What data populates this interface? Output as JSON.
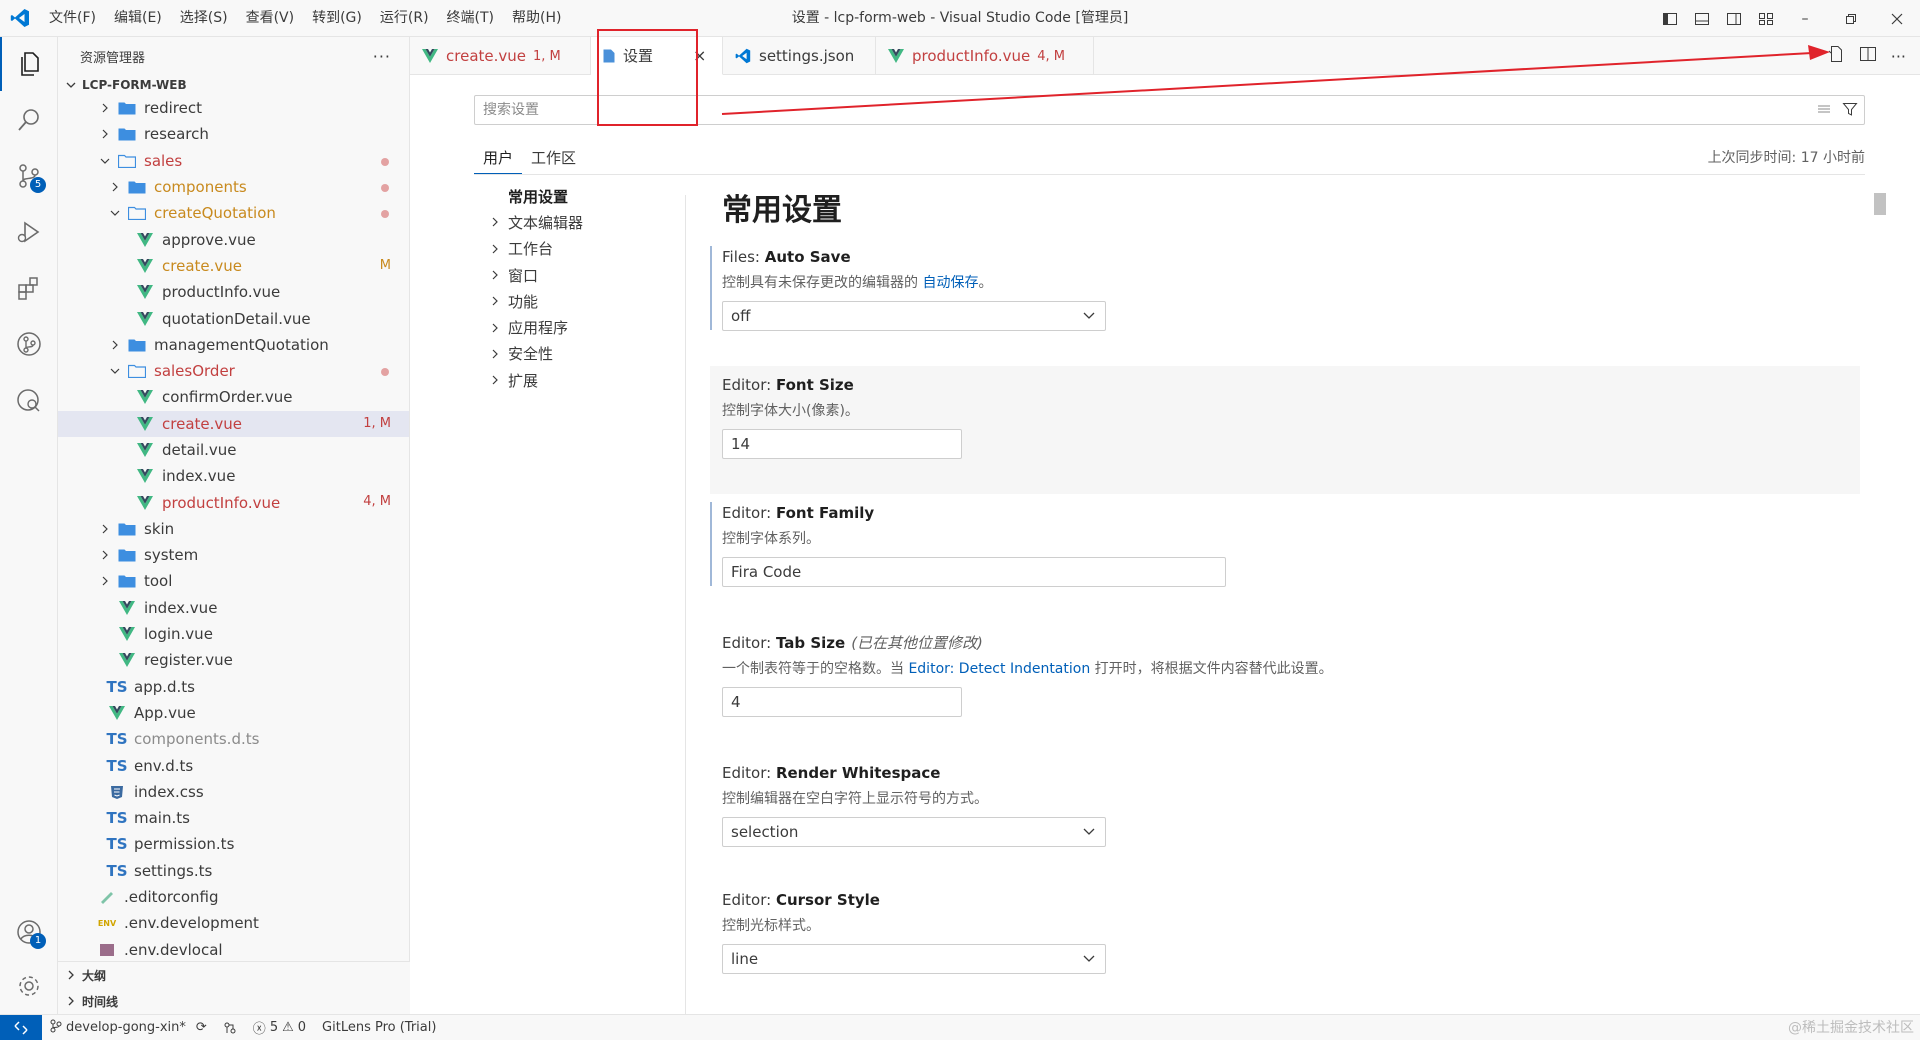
{
  "window": {
    "title": "设置 - lcp-form-web - Visual Studio Code [管理员]",
    "menu": [
      "文件(F)",
      "编辑(E)",
      "选择(S)",
      "查看(V)",
      "转到(G)",
      "运行(R)",
      "终端(T)",
      "帮助(H)"
    ]
  },
  "activitybar": {
    "source_control_badge": "5",
    "accounts_badge": "1"
  },
  "sidebar": {
    "title": "资源管理器",
    "more": "···",
    "root": "LCP-FORM-WEB",
    "items": [
      {
        "label": "redirect",
        "status": ""
      },
      {
        "label": "research",
        "status": ""
      },
      {
        "label": "sales",
        "status": ""
      },
      {
        "label": "components",
        "status": ""
      },
      {
        "label": "createQuotation",
        "status": ""
      },
      {
        "label": "approve.vue",
        "status": ""
      },
      {
        "label": "create.vue",
        "status": "M"
      },
      {
        "label": "productInfo.vue",
        "status": ""
      },
      {
        "label": "quotationDetail.vue",
        "status": ""
      },
      {
        "label": "managementQuotation",
        "status": ""
      },
      {
        "label": "salesOrder",
        "status": ""
      },
      {
        "label": "confirmOrder.vue",
        "status": ""
      },
      {
        "label": "create.vue",
        "status": "1, M"
      },
      {
        "label": "detail.vue",
        "status": ""
      },
      {
        "label": "index.vue",
        "status": ""
      },
      {
        "label": "productInfo.vue",
        "status": "4, M"
      },
      {
        "label": "skin",
        "status": ""
      },
      {
        "label": "system",
        "status": ""
      },
      {
        "label": "tool",
        "status": ""
      },
      {
        "label": "index.vue",
        "status": ""
      },
      {
        "label": "login.vue",
        "status": ""
      },
      {
        "label": "register.vue",
        "status": ""
      },
      {
        "label": "app.d.ts",
        "status": ""
      },
      {
        "label": "App.vue",
        "status": ""
      },
      {
        "label": "components.d.ts",
        "status": ""
      },
      {
        "label": "env.d.ts",
        "status": ""
      },
      {
        "label": "index.css",
        "status": ""
      },
      {
        "label": "main.ts",
        "status": ""
      },
      {
        "label": "permission.ts",
        "status": ""
      },
      {
        "label": "settings.ts",
        "status": ""
      },
      {
        "label": ".editorconfig",
        "status": ""
      },
      {
        "label": ".env.development",
        "status": ""
      },
      {
        "label": ".env.devlocal",
        "status": ""
      }
    ],
    "ts_glyph": "TS",
    "env_glyph": "ENV",
    "outline": "大纲",
    "timeline": "时间线"
  },
  "tabs": [
    {
      "label": "create.vue",
      "status": "1, M"
    },
    {
      "label": "设置",
      "status": ""
    },
    {
      "label": "settings.json",
      "status": ""
    },
    {
      "label": "productInfo.vue",
      "status": "4, M"
    }
  ],
  "tab_close": "×",
  "settings": {
    "search_placeholder": "搜索设置",
    "scope_tabs": [
      "用户",
      "工作区"
    ],
    "sync_time": "上次同步时间: 17 小时前",
    "toc": [
      "常用设置",
      "文本编辑器",
      "工作台",
      "窗口",
      "功能",
      "应用程序",
      "安全性",
      "扩展"
    ],
    "section_title": "常用设置",
    "items": [
      {
        "category": "Files: ",
        "name": "Auto Save",
        "desc": "控制具有未保存更改的编辑器的",
        "link": "自动保存",
        "desc_after": "。",
        "value": "off"
      },
      {
        "category": "Editor: ",
        "name": "Font Size",
        "desc": "控制字体大小(像素)。",
        "value": "14"
      },
      {
        "category": "Editor: ",
        "name": "Font Family",
        "desc": "控制字体系列。",
        "value": "Fira Code"
      },
      {
        "category": "Editor: ",
        "name": "Tab Size",
        "note": "(已在其他位置修改)",
        "desc": "一个制表符等于的空格数。当",
        "link": "Editor: Detect Indentation",
        "desc_after": "打开时，将根据文件内容替代此设置。",
        "value": "4"
      },
      {
        "category": "Editor: ",
        "name": "Render Whitespace",
        "desc": "控制编辑器在空白字符上显示符号的方式。",
        "value": "selection"
      },
      {
        "category": "Editor: ",
        "name": "Cursor Style",
        "desc": "控制光标样式。",
        "value": "line"
      }
    ]
  },
  "statusbar": {
    "branch": "develop-gong-xin*",
    "errors": "5",
    "warnings": "0",
    "gitlens": "GitLens Pro (Trial)",
    "watermark": "@稀土掘金技术社区"
  },
  "colors": {
    "accent": "#005fb8",
    "modified": "#c24040",
    "annotation": "#e0232b",
    "vue": "#41b883"
  }
}
